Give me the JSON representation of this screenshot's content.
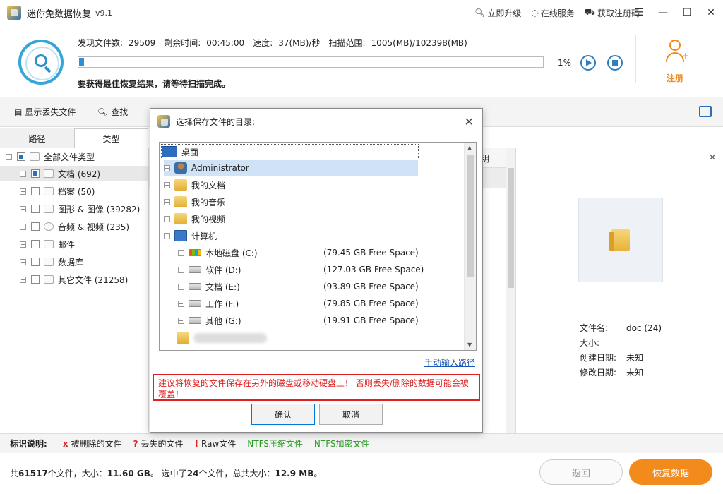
{
  "app": {
    "title": "迷你兔数据恢复",
    "version": "v9.1"
  },
  "title_actions": {
    "upgrade": "立即升级",
    "service": "在线服务",
    "register_code": "获取注册码"
  },
  "window": {
    "menu": "☰",
    "minimize": "—",
    "maximize": "☐",
    "close": "✕"
  },
  "scan": {
    "found_label": "发现文件数:",
    "found_value": "29509",
    "remaining_label": "剩余时间:",
    "remaining_value": "00:45:00",
    "speed_label": "速度:",
    "speed_value": "37(MB)/秒",
    "range_label": "扫描范围:",
    "range_value": "1005(MB)/102398(MB)",
    "percent": "1%",
    "progress_fraction": 0.01,
    "hint": "要获得最佳恢复结果，请等待扫描完成。"
  },
  "register": {
    "label": "注册"
  },
  "toolbar": {
    "show_lost": "显示丢失文件",
    "search": "查找"
  },
  "tabs": {
    "path": "路径",
    "type": "类型"
  },
  "tree": {
    "root": "全部文件类型",
    "items": [
      {
        "label": "文档 (692)"
      },
      {
        "label": "档案 (50)"
      },
      {
        "label": "图形 & 图像 (39282)"
      },
      {
        "label": "音频 & 视频 (235)"
      },
      {
        "label": "邮件"
      },
      {
        "label": "数据库"
      },
      {
        "label": "其它文件 (21258)"
      }
    ]
  },
  "list": {
    "col_fragment": "明"
  },
  "preview": {
    "name_label": "文件名:",
    "name_value": "doc (24)",
    "size_label": "大小:",
    "size_value": "",
    "created_label": "创建日期:",
    "created_value": "未知",
    "modified_label": "修改日期:",
    "modified_value": "未知"
  },
  "dialog": {
    "title": "选择保存文件的目录:",
    "root": "桌面",
    "items": [
      {
        "label": "Administrator"
      },
      {
        "label": "我的文档"
      },
      {
        "label": "我的音乐"
      },
      {
        "label": "我的视频"
      },
      {
        "label": "计算机"
      }
    ],
    "drives": [
      {
        "label": "本地磁盘 (C:)",
        "free": "(79.45 GB Free Space)"
      },
      {
        "label": "软件 (D:)",
        "free": "(127.03 GB Free Space)"
      },
      {
        "label": "文档 (E:)",
        "free": "(93.89 GB Free Space)"
      },
      {
        "label": "工作 (F:)",
        "free": "(79.85 GB Free Space)"
      },
      {
        "label": "其他 (G:)",
        "free": "(19.91 GB Free Space)"
      }
    ],
    "manual_path": "手动输入路径",
    "warning": "建议将恢复的文件保存在另外的磁盘或移动硬盘上！ 否则丢失/删除的数据可能会被覆盖！",
    "ok": "确认",
    "cancel": "取消"
  },
  "legend": {
    "title": "标识说明:",
    "deleted": "被删除的文件",
    "lost": "丢失的文件",
    "raw": "Raw文件",
    "ntfs_compressed": "NTFS压缩文件",
    "ntfs_encrypted": "NTFS加密文件"
  },
  "status": {
    "prefix": "共",
    "total_files": "61517",
    "mid1": "个文件，大小：",
    "total_size": "11.60 GB",
    "mid2": "。 选中了",
    "selected_files": "24",
    "mid3": "个文件，总共大小：",
    "selected_size": "12.9 MB",
    "suffix": "。"
  },
  "buttons": {
    "back": "返回",
    "recover": "恢复数据"
  },
  "colors": {
    "accent": "#2f8fd0",
    "orange": "#f28a1c",
    "warning": "#e02020",
    "green": "#2a9a2a"
  }
}
